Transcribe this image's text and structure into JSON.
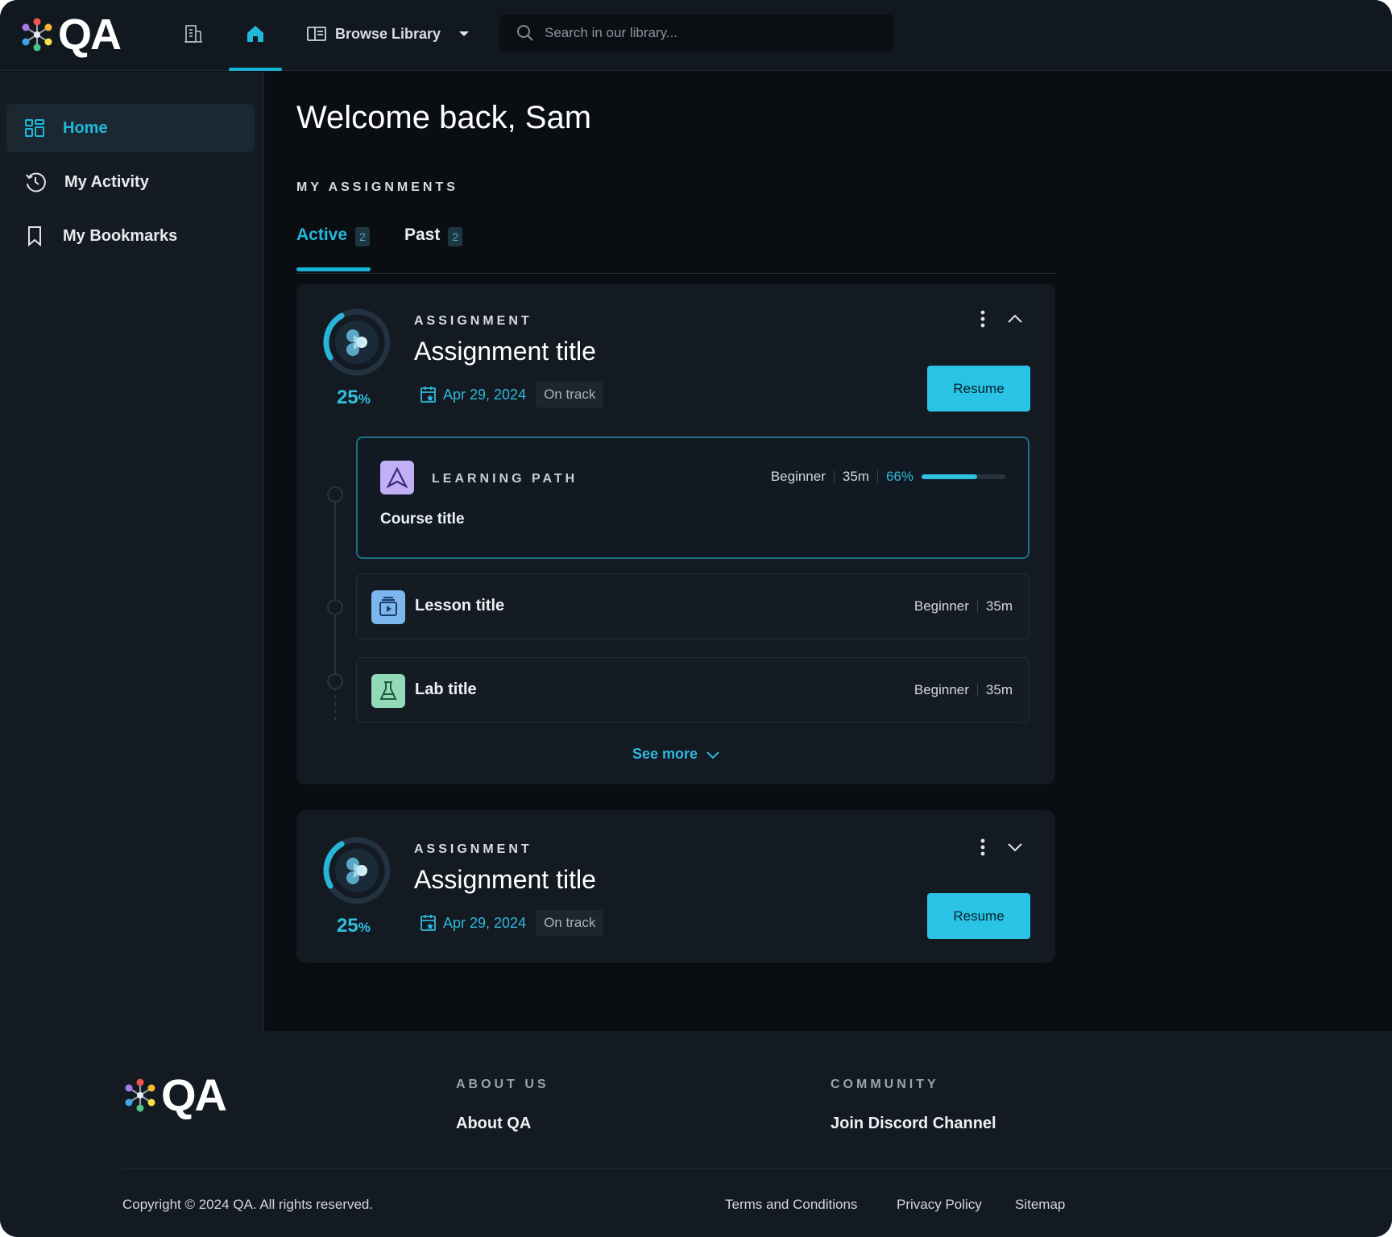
{
  "brand": {
    "logo_text": "QA"
  },
  "topbar": {
    "browse_label": "Browse Library",
    "search_placeholder": "Search in our library..."
  },
  "sidebar": {
    "items": [
      {
        "label": "Home",
        "icon": "grid-icon",
        "active": true
      },
      {
        "label": "My Activity",
        "icon": "history-icon",
        "active": false
      },
      {
        "label": "My Bookmarks",
        "icon": "bookmark-icon",
        "active": false
      }
    ]
  },
  "main": {
    "welcome": "Welcome back, Sam",
    "section_label": "MY ASSIGNMENTS",
    "tabs": [
      {
        "label": "Active",
        "count": "2",
        "active": true
      },
      {
        "label": "Past",
        "count": "2",
        "active": false
      }
    ],
    "assignments": [
      {
        "eyebrow": "ASSIGNMENT",
        "title": "Assignment title",
        "progress_value": "25",
        "progress_unit": "%",
        "progress_fraction": 0.25,
        "date": "Apr 29, 2024",
        "status": "On track",
        "button": "Resume",
        "expanded": true,
        "items": [
          {
            "type_label": "LEARNING PATH",
            "title": "Course title",
            "level": "Beginner",
            "duration": "35m",
            "progress_text": "66%",
            "progress_fraction": 0.66,
            "icon": "learning-path-icon"
          },
          {
            "title": "Lesson title",
            "level": "Beginner",
            "duration": "35m",
            "icon": "lesson-icon"
          },
          {
            "title": "Lab title",
            "level": "Beginner",
            "duration": "35m",
            "icon": "lab-icon"
          }
        ],
        "see_more": "See more"
      },
      {
        "eyebrow": "ASSIGNMENT",
        "title": "Assignment title",
        "progress_value": "25",
        "progress_unit": "%",
        "progress_fraction": 0.25,
        "date": "Apr 29, 2024",
        "status": "On track",
        "button": "Resume",
        "expanded": false
      }
    ]
  },
  "footer": {
    "about_heading": "ABOUT US",
    "about_link": "About QA",
    "community_heading": "COMMUNITY",
    "community_link": "Join Discord Channel",
    "copyright": "Copyright © 2024 QA. All rights reserved.",
    "legal_links": [
      "Terms and Conditions",
      "Privacy Policy",
      "Sitemap"
    ]
  },
  "colors": {
    "accent": "#2ac3e5",
    "background": "#0a0e13",
    "surface": "#131a22",
    "learning_path": "#b9a3f5",
    "lesson": "#7bb7f0",
    "lab": "#8fd9b4"
  }
}
